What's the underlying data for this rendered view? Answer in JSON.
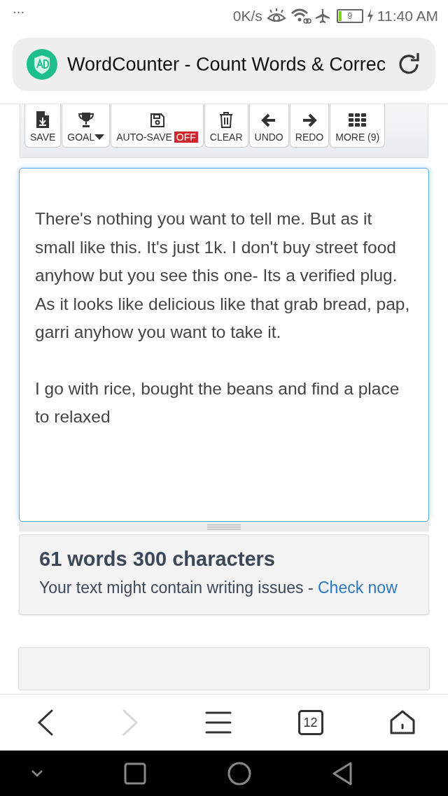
{
  "status_bar": {
    "menu": "...",
    "speed": "0K/s",
    "battery": "9",
    "time": "11:40 AM"
  },
  "address_bar": {
    "title": "WordCounter - Count Words & Correc"
  },
  "toolbar": [
    {
      "kind": "save",
      "label": "SAVE"
    },
    {
      "kind": "goal",
      "label": "GOAL"
    },
    {
      "kind": "autosave",
      "label": "AUTO-SAVE",
      "badge": "OFF"
    },
    {
      "kind": "clear",
      "label": "CLEAR"
    },
    {
      "kind": "undo",
      "label": "UNDO"
    },
    {
      "kind": "redo",
      "label": "REDO"
    },
    {
      "kind": "more",
      "label": "MORE (9)"
    }
  ],
  "editor": {
    "paragraphs": [
      "There's nothing you want to tell me. But as it small like this. It's just 1k. I don't buy street food anyhow but you see this one- Its a verified plug. As it looks like delicious like that grab bread, pap, garri anyhow you want to take it.",
      "I go with rice, bought the beans and find a place to relaxed"
    ]
  },
  "stats": {
    "summary": "61 words 300 characters",
    "message": "Your text might contain writing issues - ",
    "link": "Check now"
  },
  "browser_nav": [
    {
      "kind": "back",
      "disabled": false
    },
    {
      "kind": "forward",
      "disabled": true
    },
    {
      "kind": "menu",
      "disabled": false
    },
    {
      "kind": "tabs",
      "count": "12",
      "disabled": false
    },
    {
      "kind": "home",
      "disabled": false
    }
  ]
}
